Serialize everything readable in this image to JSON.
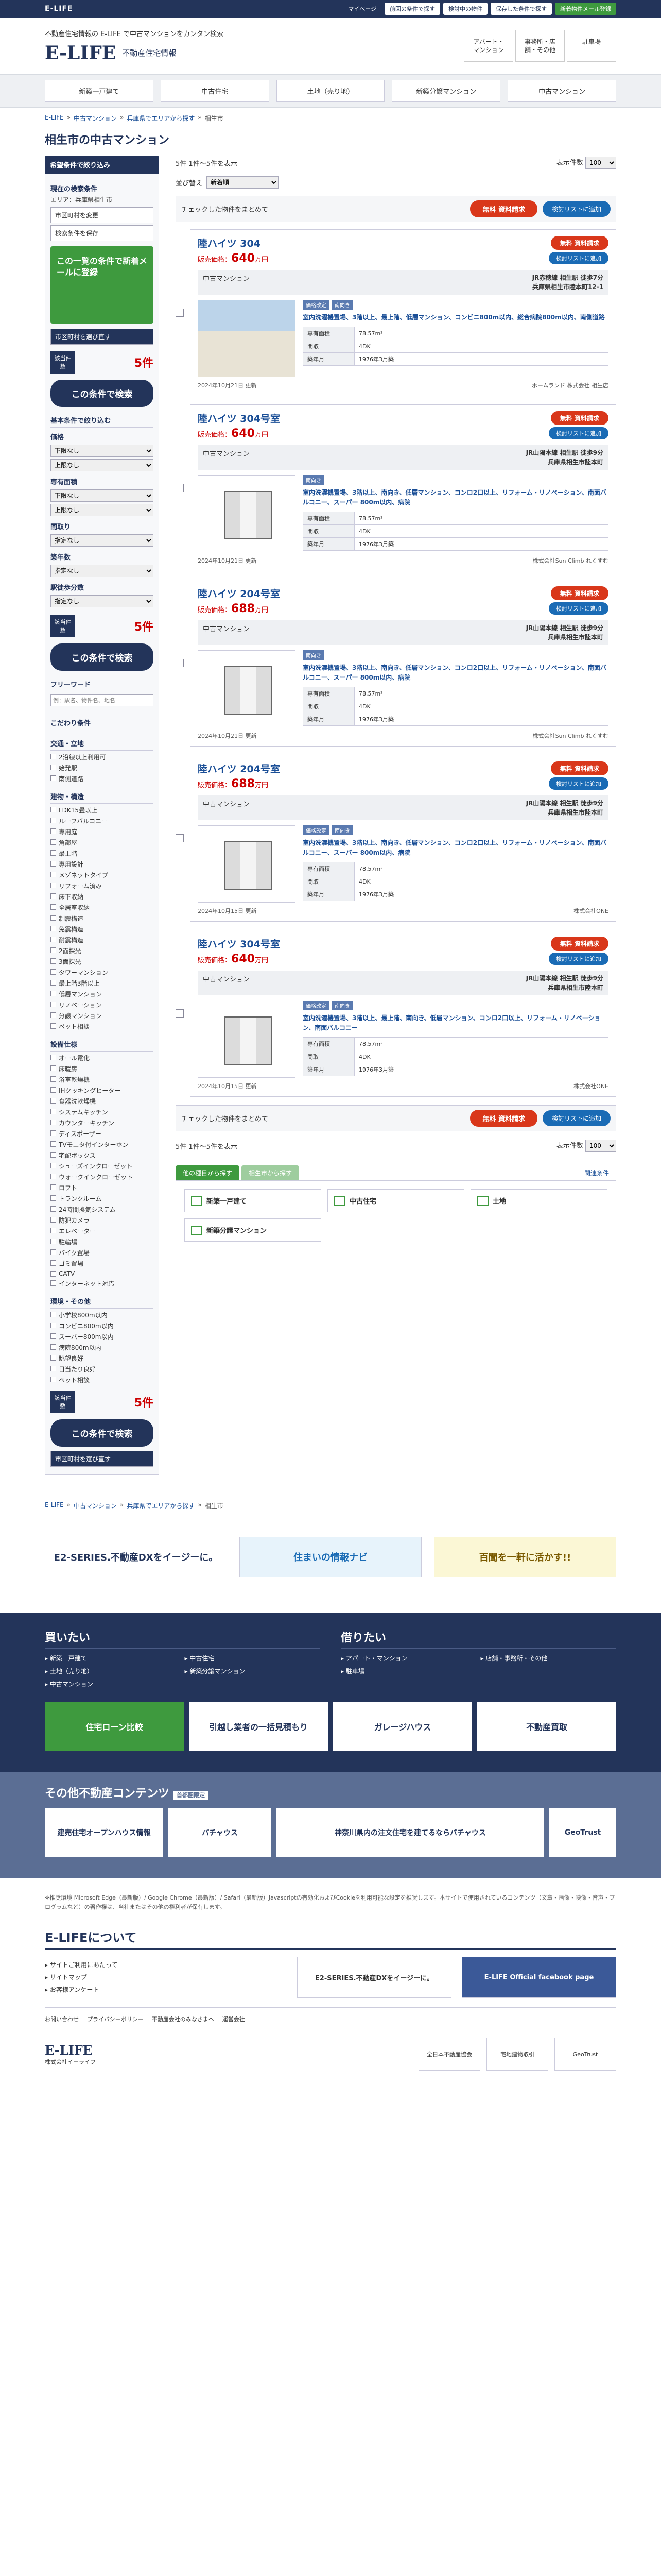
{
  "topbar": {
    "brand": "E-LIFE",
    "mypage": "マイページ",
    "links": [
      "前回の条件で探す",
      "検討中の物件",
      "保存した条件で探す",
      "新着物件メール登録"
    ]
  },
  "header": {
    "tagline": "不動産住宅情報の E-LIFE で中古マンションをカンタン検索",
    "logo": "E-LIFE",
    "logo_sub": "不動産住宅情報",
    "links": [
      "アパート・マンション",
      "事務所・店舗・その他",
      "駐車場"
    ]
  },
  "gnav": [
    "新築一戸建て",
    "中古住宅",
    "土地（売り地）",
    "新築分譲マンション",
    "中古マンション"
  ],
  "crumb": [
    "E-LIFE",
    "中古マンション",
    "兵庫県でエリアから探す",
    "相生市"
  ],
  "title": "相生市の中古マンション",
  "side": {
    "head": "希望条件で絞り込み",
    "current_label": "現在の検索条件",
    "area": "エリア：兵庫県相生市",
    "btn_area": "市区町村を変更",
    "btn_save": "検索条件を保存",
    "banner": "この一覧の条件で新着メールに登録",
    "btn_mail": "市区町村を選び直す",
    "count_label": "該当件数",
    "count": "5件",
    "search": "この条件で検索",
    "basic": "基本条件で絞り込む",
    "price": "価格",
    "price_min": "下限なし",
    "price_max": "上限なし",
    "area_label": "専有面積",
    "area_min": "下限なし",
    "area_max": "上限なし",
    "plan": "間取り",
    "plan_val": "指定なし",
    "age": "築年数",
    "age_val": "指定なし",
    "walk": "駅徒歩分数",
    "walk_val": "指定なし",
    "free": "フリーワード",
    "free_ph": "例：駅名、物件名、地名",
    "detail": "こだわり条件",
    "groups": [
      {
        "name": "交通・立地",
        "items": [
          "2沿線以上利用可",
          "始発駅",
          "南側道路"
        ]
      },
      {
        "name": "建物・構造",
        "items": [
          "LDK15畳以上",
          "ルーフバルコニー",
          "専用庭",
          "角部屋",
          "最上階",
          "専用設計",
          "メゾネットタイプ",
          "リフォーム済み",
          "床下収納",
          "全居室収納",
          "制震構造",
          "免震構造",
          "耐震構造",
          "2面採光",
          "3面採光",
          "タワーマンション",
          "最上階3階以上",
          "低層マンション",
          "リノベーション",
          "分譲マンション",
          "ペット相談"
        ]
      },
      {
        "name": "設備仕様",
        "items": [
          "オール電化",
          "床暖房",
          "浴室乾燥機",
          "IHクッキングヒーター",
          "食器洗乾燥機",
          "システムキッチン",
          "カウンターキッチン",
          "ディスポーザー",
          "TVモニタ付インターホン",
          "宅配ボックス",
          "シューズインクローゼット",
          "ウォークインクローゼット",
          "ロフト",
          "トランクルーム",
          "24時間換気システム",
          "防犯カメラ",
          "エレベーター",
          "駐輪場",
          "バイク置場",
          "ゴミ置場",
          "CATV",
          "インターネット対応"
        ]
      },
      {
        "name": "環境・その他",
        "items": [
          "小学校800m以内",
          "コンビニ800m以内",
          "スーパー800m以内",
          "病院800m以内",
          "眺望良好",
          "日当たり良好",
          "ペット相談"
        ]
      }
    ]
  },
  "main": {
    "results": "5件 1件〜5件を表示",
    "perpage_label": "表示件数",
    "perpage": "100",
    "sort_label": "並び替え",
    "sort": "新着順",
    "check_all": "チェックした物件をまとめて",
    "req": "資料請求",
    "req_free": "無料",
    "fav": "検討リストに追加",
    "listings": [
      {
        "name": "陸ハイツ 304",
        "price_label": "販売価格：",
        "price": "640",
        "unit": "万円",
        "type": "中古マンション",
        "access": "JR赤穂線 相生駅 徒歩7分",
        "addr": "兵庫県相生市陸本町12-1",
        "tags": [
          "価格改定",
          "南向き"
        ],
        "feat": "室内洗濯機置場、3階以上、最上階、低層マンション、コンビニ800m以内、総合病院800m以内、南側道路",
        "area": "78.57m²",
        "plan": "4DK",
        "built": "1976年3月築",
        "date": "2024年10月21日 更新",
        "company": "ホームランド 株式会社 相生店",
        "img": "photo"
      },
      {
        "name": "陸ハイツ 304号室",
        "price_label": "販売価格：",
        "price": "640",
        "unit": "万円",
        "type": "中古マンション",
        "access": "JR山陽本線 相生駅 徒歩9分",
        "addr": "兵庫県相生市陸本町",
        "tags": [
          "南向き"
        ],
        "feat": "室内洗濯機置場、3階以上、南向き、低層マンション、コンロ2口以上、リフォーム・リノベーション、南面バルコニー、スーパー 800m以内、病院",
        "area": "78.57m²",
        "plan": "4DK",
        "built": "1976年3月築",
        "date": "2024年10月21日 更新",
        "company": "株式会社Sun Climb れくすむ",
        "img": "plan"
      },
      {
        "name": "陸ハイツ 204号室",
        "price_label": "販売価格：",
        "price": "688",
        "unit": "万円",
        "type": "中古マンション",
        "access": "JR山陽本線 相生駅 徒歩9分",
        "addr": "兵庫県相生市陸本町",
        "tags": [
          "南向き"
        ],
        "feat": "室内洗濯機置場、3階以上、南向き、低層マンション、コンロ2口以上、リフォーム・リノベーション、南面バルコニー、スーパー 800m以内、病院",
        "area": "78.57m²",
        "plan": "4DK",
        "built": "1976年3月築",
        "date": "2024年10月21日 更新",
        "company": "株式会社Sun Climb れくすむ",
        "img": "plan"
      },
      {
        "name": "陸ハイツ 204号室",
        "price_label": "販売価格：",
        "price": "688",
        "unit": "万円",
        "type": "中古マンション",
        "access": "JR山陽本線 相生駅 徒歩9分",
        "addr": "兵庫県相生市陸本町",
        "tags": [
          "価格改定",
          "南向き"
        ],
        "feat": "室内洗濯機置場、3階以上、南向き、低層マンション、コンロ2口以上、リフォーム・リノベーション、南面バルコニー、スーパー 800m以内、病院",
        "area": "78.57m²",
        "plan": "4DK",
        "built": "1976年3月築",
        "date": "2024年10月15日 更新",
        "company": "株式会社ONE",
        "img": "plan"
      },
      {
        "name": "陸ハイツ 304号室",
        "price_label": "販売価格：",
        "price": "640",
        "unit": "万円",
        "type": "中古マンション",
        "access": "JR山陽本線 相生駅 徒歩9分",
        "addr": "兵庫県相生市陸本町",
        "tags": [
          "価格改定",
          "南向き"
        ],
        "feat": "室内洗濯機置場、3階以上、最上階、南向き、低層マンション、コンロ2口以上、リフォーム・リノベーション、南面バルコニー",
        "area": "78.57m²",
        "plan": "4DK",
        "built": "1976年3月築",
        "date": "2024年10月15日 更新",
        "company": "株式会社ONE",
        "img": "plan"
      }
    ],
    "spec_labels": [
      "専有面積",
      "間取",
      "築年月"
    ],
    "tabs": [
      "他の種目から探す",
      "相生市から探す"
    ],
    "conds": "関連条件",
    "related": [
      "新築一戸建て",
      "中古住宅",
      "土地",
      "新築分譲マンション"
    ]
  },
  "banners": [
    "E2-SERIES.不動産DXをイージーに。",
    "住まいの情報ナビ",
    "百聞を一軒に活かす!!"
  ],
  "footer": {
    "buy": "買いたい",
    "buy_items": [
      "新築一戸建て",
      "中古住宅",
      "土地（売り地）",
      "新築分譲マンション",
      "中古マンション"
    ],
    "rent": "借りたい",
    "rent_items": [
      "アパート・マンション",
      "店舗・事務所・その他",
      "駐車場"
    ],
    "ads": [
      "住宅ローン比較",
      "引越し業者の一括見積もり",
      "ガレージハウス",
      "不動産買取"
    ]
  },
  "other": {
    "title": "その他不動産コンテンツ",
    "badge": "首都圏限定",
    "items": [
      "建売住宅オープンハウス情報",
      "パチャウス",
      "神奈川県内の注文住宅を建てるならパチャウス",
      "GeoTrust"
    ]
  },
  "notes": "※推奨環境 Microsoft Edge（最新版）/ Google Chrome（最新版）/ Safari（最新版）Javascriptの有効化およびCookieを利用可能な設定を推奨します。本サイトで使用されているコンテンツ（文章・画像・映像・音声・プログラムなど）の著作権は、当社またはその他の権利者が保有します。",
  "about": {
    "title": "E-LIFEについて",
    "items": [
      "サイトご利用にあたって",
      "サイトマップ",
      "お客様アンケート"
    ],
    "ad1": "E2-SERIES.不動産DXをイージーに。",
    "ad2": "E-LIFE Official facebook page"
  },
  "links": [
    "お問い合わせ",
    "プライバシーポリシー",
    "不動産会社のみなさまへ",
    "運営会社"
  ],
  "bottom": {
    "org": "株式会社イーライフ",
    "marks": [
      "全日本不動産協会",
      "宅地建物取引",
      "GeoTrust"
    ]
  }
}
